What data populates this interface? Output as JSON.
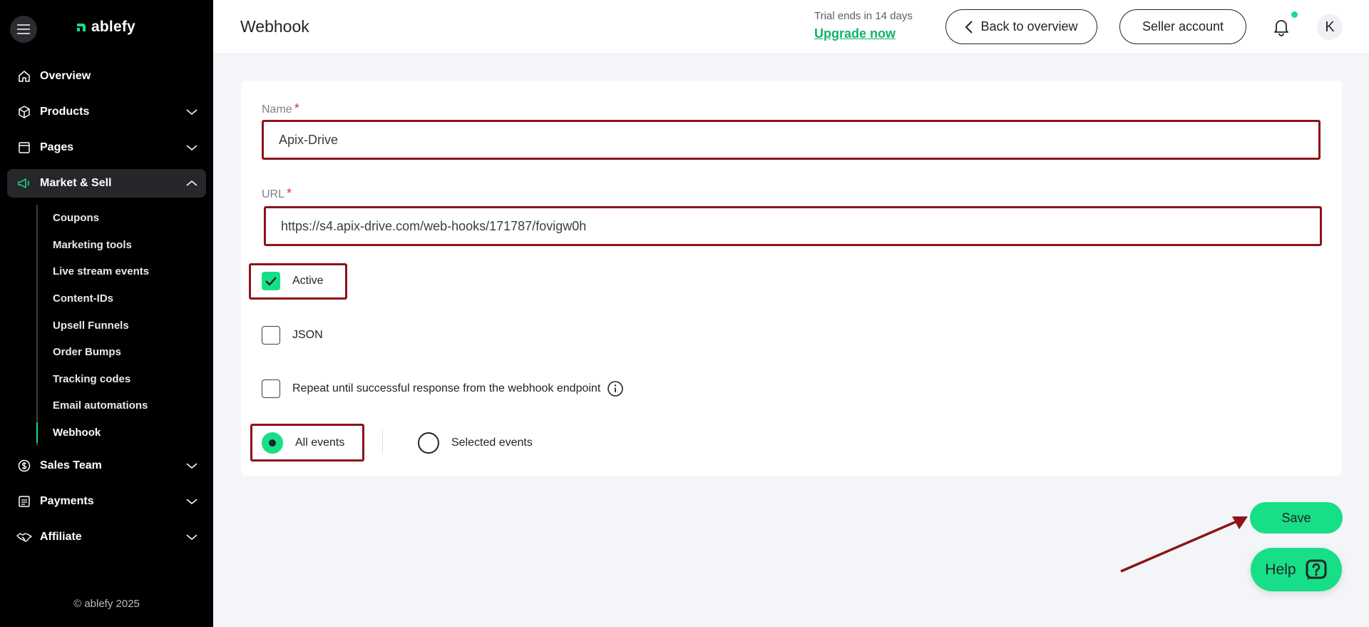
{
  "app": {
    "logo_text": "ablefy"
  },
  "sidebar": {
    "nav": [
      {
        "label": "Overview",
        "icon": "home-icon"
      },
      {
        "label": "Products",
        "icon": "box-icon"
      },
      {
        "label": "Pages",
        "icon": "browser-icon"
      },
      {
        "label": "Market & Sell",
        "icon": "megaphone-icon"
      }
    ],
    "market_sell_sub": [
      "Coupons",
      "Marketing tools",
      "Live stream events",
      "Content-IDs",
      "Upsell Funnels",
      "Order Bumps",
      "Tracking codes",
      "Email automations",
      "Webhook"
    ],
    "nav_bottom": [
      {
        "label": "Sales Team",
        "icon": "dollar-circle-icon"
      },
      {
        "label": "Payments",
        "icon": "receipt-icon"
      },
      {
        "label": "Affiliate",
        "icon": "handshake-icon"
      }
    ],
    "copyright": "© ablefy 2025"
  },
  "header": {
    "title": "Webhook",
    "trial_text": "Trial ends in 14 days",
    "upgrade_label": "Upgrade now",
    "back_label": "Back to overview",
    "seller_label": "Seller account",
    "avatar_initial": "K"
  },
  "form": {
    "name_label": "Name",
    "name_value": "Apix-Drive",
    "url_label": "URL",
    "url_value": "https://s4.apix-drive.com/web-hooks/171787/fovigw0h",
    "required_mark": "*",
    "active_label": "Active",
    "active_checked": true,
    "json_label": "JSON",
    "json_checked": false,
    "repeat_label": "Repeat until successful response from the webhook endpoint",
    "repeat_checked": false,
    "all_events_label": "All events",
    "selected_events_label": "Selected events",
    "events_mode": "All events"
  },
  "actions": {
    "save_label": "Save",
    "help_label": "Help"
  },
  "colors": {
    "accent": "#17df87",
    "annotation": "#8c1319",
    "sidebar_bg": "#000000"
  }
}
